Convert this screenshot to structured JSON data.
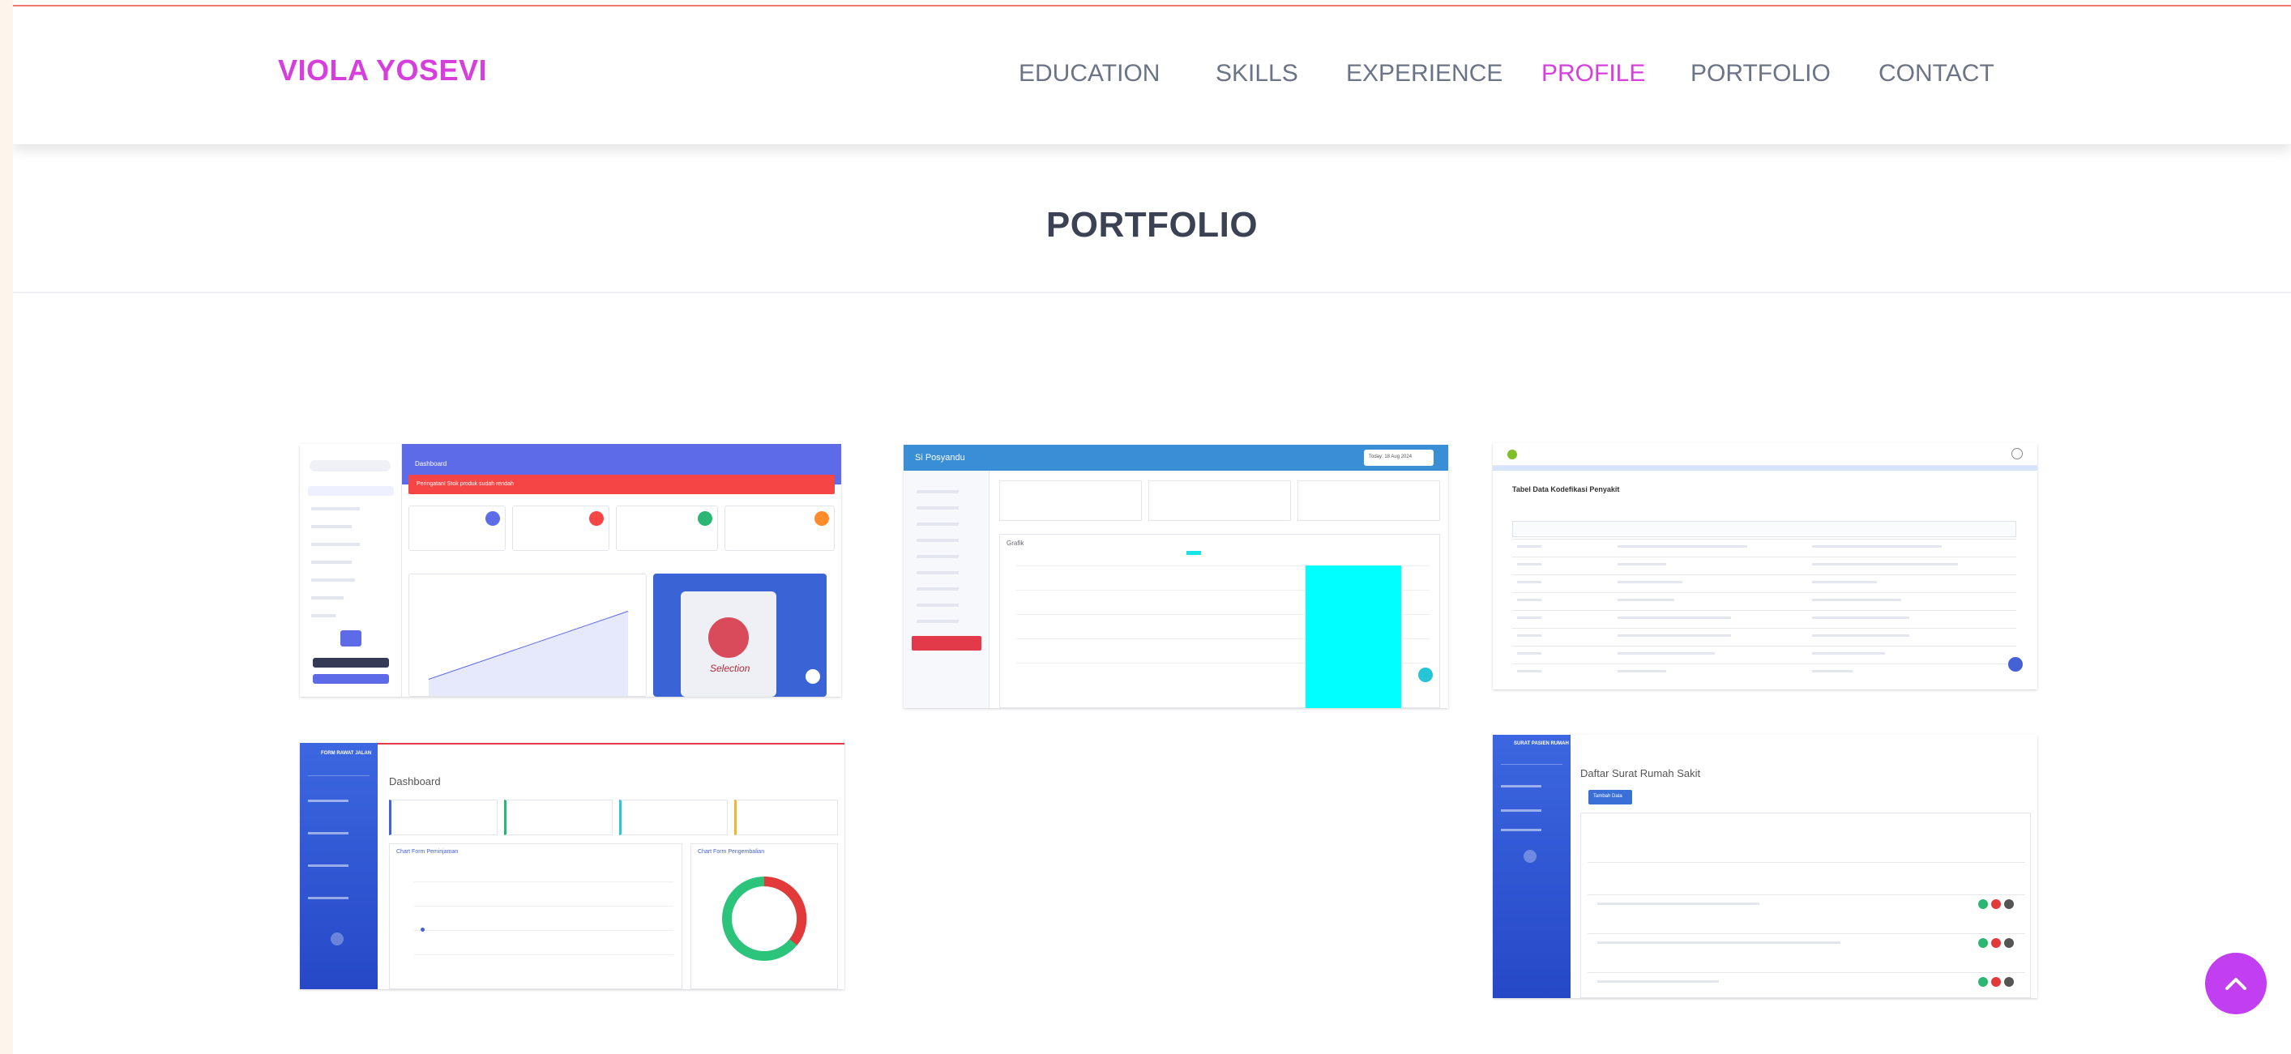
{
  "brand": "VIOLA YOSEVI",
  "nav": [
    {
      "label": "EDUCATION",
      "active": false
    },
    {
      "label": "SKILLS",
      "active": false
    },
    {
      "label": "EXPERIENCE",
      "active": false
    },
    {
      "label": "PROFILE",
      "active": true
    },
    {
      "label": "PORTFOLIO",
      "active": false
    },
    {
      "label": "CONTACT",
      "active": false
    }
  ],
  "section_title": "PORTFOLIO",
  "colors": {
    "accent": "#d63fdc",
    "nav_text": "#6b7487",
    "title": "#3b4253",
    "scroll_button": "#c13ff0"
  },
  "portfolio": [
    {
      "app": "dashboard",
      "header": "Dashboard",
      "alert": "Peringatan! Stok produk sudah rendah",
      "card": "Selection"
    },
    {
      "app": "Si Posyandu",
      "date_badge": "Today: 18 Aug 2024",
      "section": "Grafik"
    },
    {
      "app": "penyakit",
      "heading": "Tabel Data Kodefikasi Penyakit"
    },
    {
      "app": "FORM RAWAT JALAN",
      "header": "Dashboard",
      "chart_left": "Chart Form Peminjaman",
      "chart_right": "Chart Form Pengembalian"
    },
    {
      "app": "SURAT PASIEN RUMAH SAKIT",
      "header": "Daftar Surat Rumah Sakit",
      "button": "Tambah Data"
    }
  ],
  "scroll_top_icon": "chevron-up-icon"
}
